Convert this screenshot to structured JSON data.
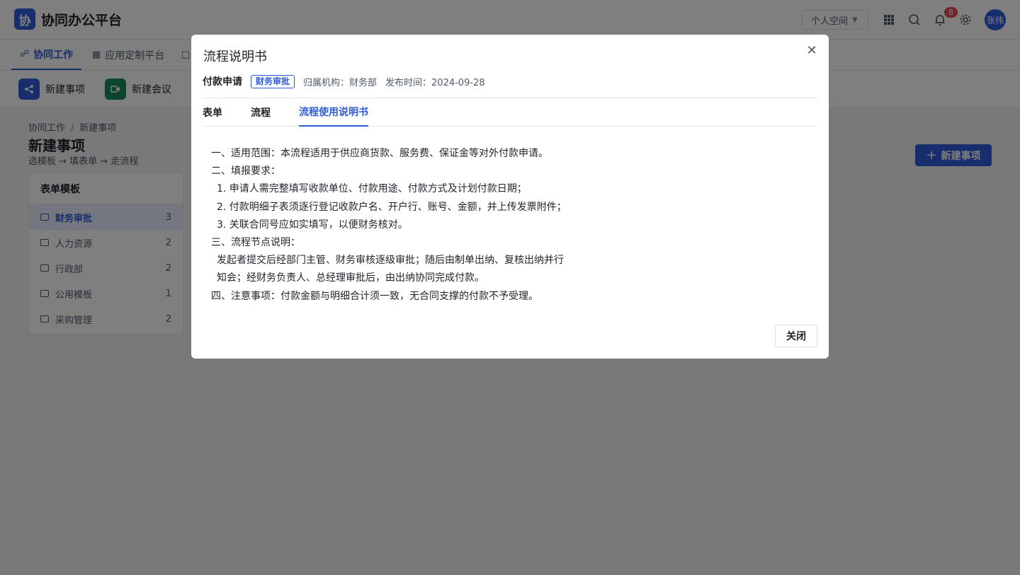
{
  "header": {
    "logo_char": "协",
    "app_title": "协同办公平台",
    "space_select": "个人空间",
    "notification_count": "8",
    "avatar_text": "张伟"
  },
  "nav": {
    "tabs": [
      {
        "label": "协同工作",
        "active": true
      },
      {
        "label": "应用定制平台",
        "active": false
      },
      {
        "label": "",
        "active": false
      }
    ]
  },
  "quick_actions": [
    {
      "label": "新建事项",
      "icon": "share-icon",
      "color": "#2f5bd8"
    },
    {
      "label": "新建会议",
      "icon": "video-icon",
      "color": "#168a5a"
    }
  ],
  "page": {
    "breadcrumb": [
      "协同工作",
      "新建事项"
    ],
    "title": "新建事项",
    "subtitle": "选模板 → 填表单 → 走流程",
    "new_button": "新建事项"
  },
  "template_panel": {
    "title": "表单模板",
    "items": [
      {
        "label": "财务审批",
        "count": "3",
        "active": true
      },
      {
        "label": "人力资源",
        "count": "2",
        "active": false
      },
      {
        "label": "行政部",
        "count": "2",
        "active": false
      },
      {
        "label": "公用模板",
        "count": "1",
        "active": false
      },
      {
        "label": "采购管理",
        "count": "2",
        "active": false
      }
    ]
  },
  "modal": {
    "title": "流程说明书",
    "process_name": "付款申请",
    "tag": "财务审批",
    "org": "归属机构：财务部",
    "publish_time": "发布时间：2024-09-28",
    "tabs": [
      {
        "label": "表单",
        "active": false
      },
      {
        "label": "流程",
        "active": false
      },
      {
        "label": "流程使用说明书",
        "active": true
      }
    ],
    "manual_lines": [
      "一、适用范围：本流程适用于供应商货款、服务费、保证金等对外付款申请。",
      "二、填报要求：",
      "1. 申请人需完整填写收款单位、付款用途、付款方式及计划付款日期；",
      "2. 付款明细子表须逐行登记收款户名、开户行、账号、金额，并上传发票附件；",
      "3. 关联合同号应如实填写，以便财务核对。",
      "三、流程节点说明：",
      "发起者提交后经部门主管、财务审核逐级审批；随后由制单出纳、复核出纳并行",
      "知会；经财务负责人、总经理审批后，由出纳协同完成付款。",
      "四、注意事项：付款金额与明细合计须一致，无合同支撑的付款不予受理。"
    ],
    "close_button": "关闭"
  }
}
